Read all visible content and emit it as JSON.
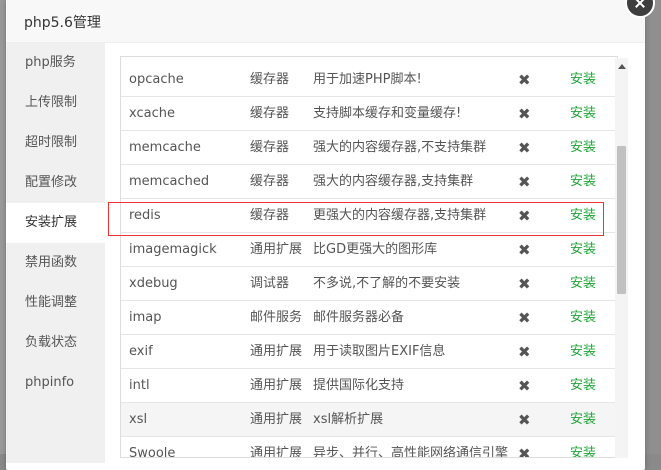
{
  "dialog": {
    "title": "php5.6管理"
  },
  "sidebar": {
    "items": [
      {
        "label": "php服务",
        "active": false
      },
      {
        "label": "上传限制",
        "active": false
      },
      {
        "label": "超时限制",
        "active": false
      },
      {
        "label": "配置修改",
        "active": false
      },
      {
        "label": "安装扩展",
        "active": true
      },
      {
        "label": "禁用函数",
        "active": false
      },
      {
        "label": "性能调整",
        "active": false
      },
      {
        "label": "负载状态",
        "active": false
      },
      {
        "label": "phpinfo",
        "active": false
      }
    ]
  },
  "extensions": [
    {
      "name": "opcache",
      "type": "缓存器",
      "desc": "用于加速PHP脚本!",
      "status": "✖",
      "action": "安装"
    },
    {
      "name": "xcache",
      "type": "缓存器",
      "desc": "支持脚本缓存和变量缓存!",
      "status": "✖",
      "action": "安装"
    },
    {
      "name": "memcache",
      "type": "缓存器",
      "desc": "强大的内容缓存器,不支持集群",
      "status": "✖",
      "action": "安装"
    },
    {
      "name": "memcached",
      "type": "缓存器",
      "desc": "强大的内容缓存器,支持集群",
      "status": "✖",
      "action": "安装"
    },
    {
      "name": "redis",
      "type": "缓存器",
      "desc": "更强大的内容缓存器,支持集群",
      "status": "✖",
      "action": "安装"
    },
    {
      "name": "imagemagick",
      "type": "通用扩展",
      "desc": "比GD更强大的图形库",
      "status": "✖",
      "action": "安装"
    },
    {
      "name": "xdebug",
      "type": "调试器",
      "desc": "不多说,不了解的不要安装",
      "status": "✖",
      "action": "安装"
    },
    {
      "name": "imap",
      "type": "邮件服务",
      "desc": "邮件服务器必备",
      "status": "✖",
      "action": "安装"
    },
    {
      "name": "exif",
      "type": "通用扩展",
      "desc": "用于读取图片EXIF信息",
      "status": "✖",
      "action": "安装"
    },
    {
      "name": "intl",
      "type": "通用扩展",
      "desc": "提供国际化支持",
      "status": "✖",
      "action": "安装"
    },
    {
      "name": "xsl",
      "type": "通用扩展",
      "desc": "xsl解析扩展",
      "status": "✖",
      "action": "安装"
    },
    {
      "name": "Swoole",
      "type": "通用扩展",
      "desc": "异步、并行、高性能网络通信引擎",
      "status": "✖",
      "action": "安装"
    }
  ],
  "colors": {
    "accent": "#20a53a",
    "highlight": "#ee3333"
  }
}
